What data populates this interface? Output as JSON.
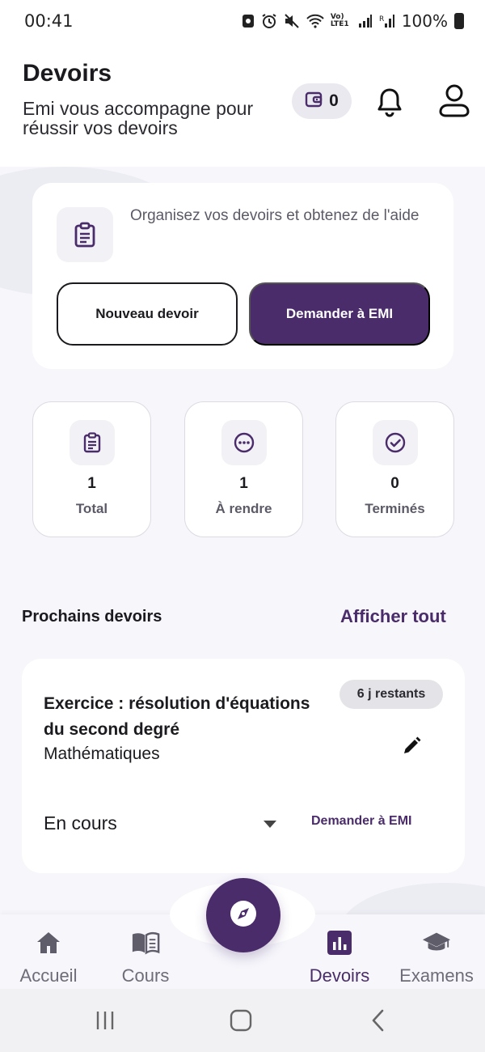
{
  "status_bar": {
    "time": "00:41",
    "battery": "100%",
    "network_label": "Vo) LTE1"
  },
  "header": {
    "title": "Devoirs",
    "subtitle": "Emi vous accompagne pour réussir vos devoirs",
    "wallet_count": "0"
  },
  "intro_card": {
    "text": "Organisez vos devoirs et obtenez de l'aide",
    "new_button": "Nouveau devoir",
    "ask_button": "Demander à EMI"
  },
  "stats": [
    {
      "value": "1",
      "label": "Total",
      "icon": "clipboard-icon"
    },
    {
      "value": "1",
      "label": "À rendre",
      "icon": "more-circle-icon"
    },
    {
      "value": "0",
      "label": "Terminés",
      "icon": "check-circle-icon"
    }
  ],
  "upcoming": {
    "section_title": "Prochains devoirs",
    "show_all": "Afficher tout",
    "items": [
      {
        "title": "Exercice : résolution d'équations du second degré",
        "subject": "Mathématiques",
        "remaining": "6 j restants",
        "status": "En cours",
        "ask_label": "Demander à EMI"
      }
    ]
  },
  "bottom_nav": {
    "items": [
      {
        "label": "Accueil",
        "icon": "home-icon",
        "active": false
      },
      {
        "label": "Cours",
        "icon": "book-icon",
        "active": false
      },
      {
        "label": "Devoirs",
        "icon": "chart-icon",
        "active": true
      },
      {
        "label": "Examens",
        "icon": "graduation-cap-icon",
        "active": false
      }
    ],
    "fab_icon": "compass-icon"
  },
  "colors": {
    "primary": "#4a2c6b",
    "background": "#f6f6fb",
    "card": "#ffffff",
    "muted_text": "#5c5a66"
  }
}
